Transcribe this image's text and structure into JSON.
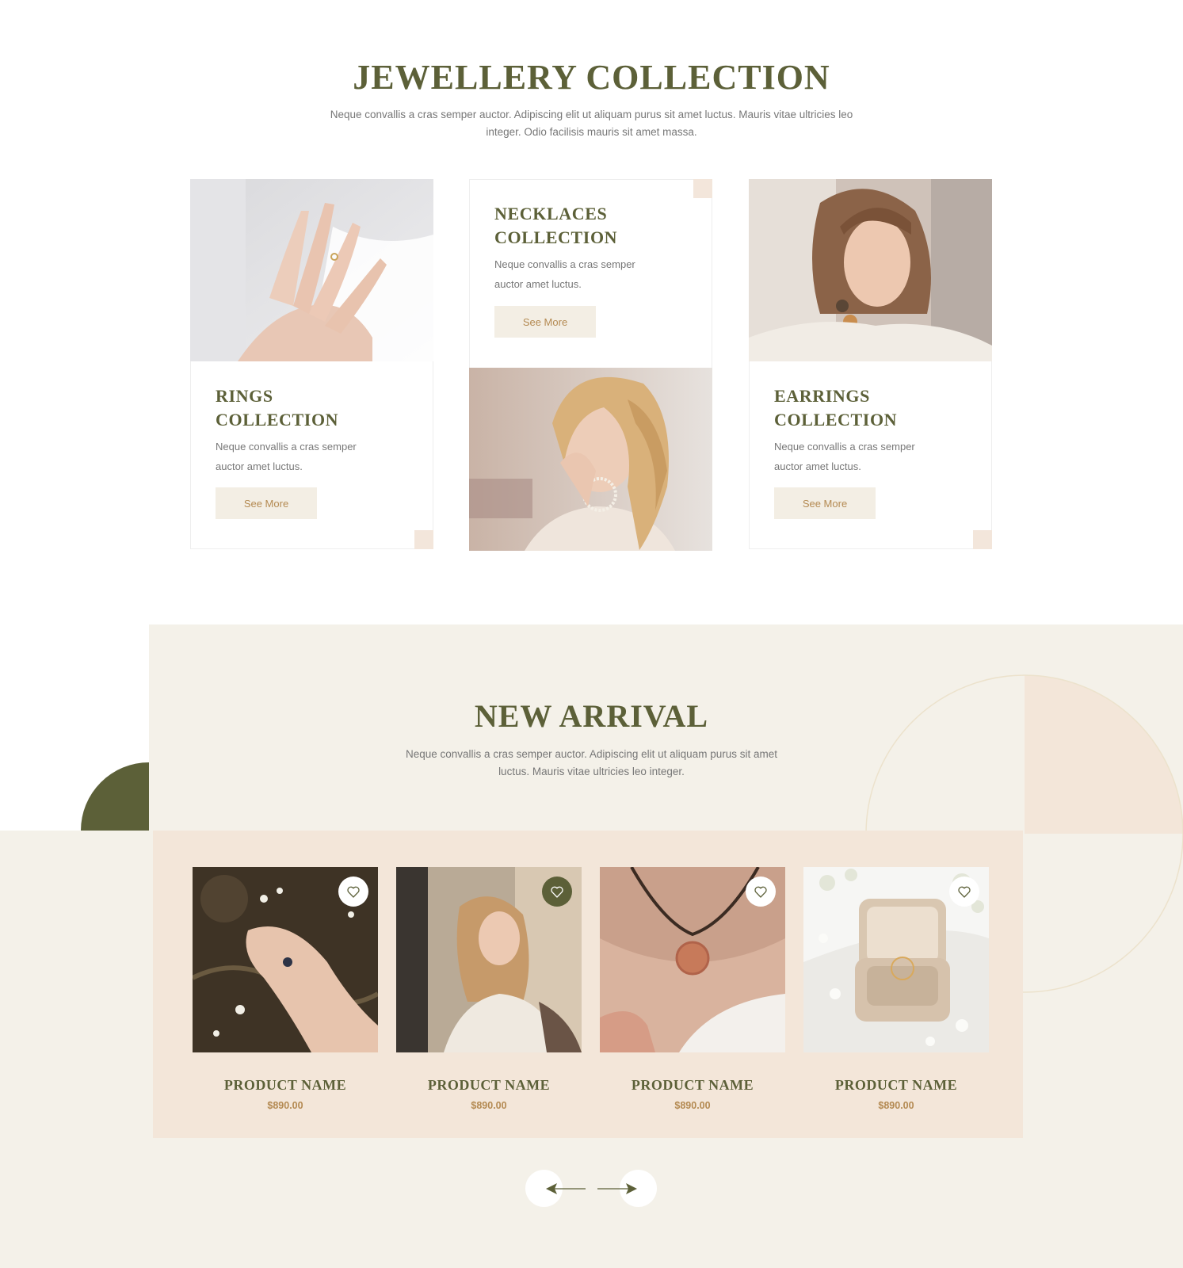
{
  "collection": {
    "title": "JEWELLERY COLLECTION",
    "description": "Neque convallis a cras semper auctor. Adipiscing elit ut aliquam purus sit amet luctus. Mauris vitae ultricies leo integer. Odio facilisis mauris sit amet massa.",
    "cards": [
      {
        "title": "RINGS COLLECTION",
        "text": "Neque convallis a cras semper auctor amet luctus.",
        "button": "See More"
      },
      {
        "title": "NECKLACES COLLECTION",
        "text": "Neque convallis a cras semper auctor amet luctus.",
        "button": "See More"
      },
      {
        "title": "EARRINGS COLLECTION",
        "text": "Neque convallis a cras semper auctor amet luctus.",
        "button": "See More"
      }
    ]
  },
  "arrivals": {
    "title": "NEW ARRIVAL",
    "description": "Neque convallis a cras semper auctor. Adipiscing elit ut aliquam purus sit amet luctus. Mauris vitae ultricies leo integer.",
    "products": [
      {
        "name": "PRODUCT NAME",
        "price": "$890.00",
        "favorited": false
      },
      {
        "name": "PRODUCT NAME",
        "price": "$890.00",
        "favorited": true
      },
      {
        "name": "PRODUCT NAME",
        "price": "$890.00",
        "favorited": false
      },
      {
        "name": "PRODUCT NAME",
        "price": "$890.00",
        "favorited": false
      }
    ]
  },
  "colors": {
    "olive": "#5c6038",
    "gold": "#b48a52",
    "cream": "#f4f1e9",
    "peach": "#f3e6d9"
  },
  "icons": [
    "heart-icon",
    "arrow-left-icon",
    "arrow-right-icon"
  ]
}
